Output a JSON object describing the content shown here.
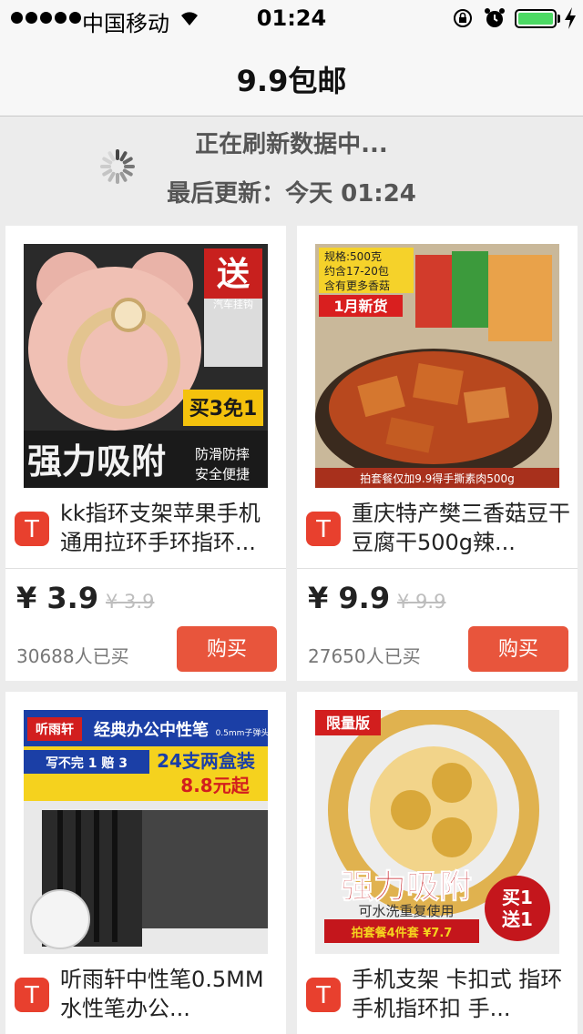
{
  "status_bar": {
    "carrier": "中国移动",
    "time": "01:24",
    "battery_level": 1.0,
    "icons": [
      "signal-dots",
      "wifi-icon",
      "orientation-lock-icon",
      "alarm-icon",
      "battery-icon",
      "charging-icon"
    ]
  },
  "nav": {
    "title": "9.9包邮"
  },
  "refresh": {
    "status": "正在刷新数据中...",
    "last_updated": "最后更新：今天 01:24"
  },
  "products": [
    {
      "title": "kk指环支架苹果手机通用拉环手环指环...",
      "price": "¥ 3.9",
      "original_price": "¥ 3.9",
      "sold": "30688人已买",
      "buy_label": "购买",
      "image_text": {
        "gift": "送",
        "gift_sub": "汽车挂钩",
        "promo": "买3免1",
        "headline": "强力吸附",
        "tag1": "防滑防摔",
        "tag2": "安全便捷"
      }
    },
    {
      "title": "重庆特产樊三香菇豆干豆腐干500g辣...",
      "price": "¥ 9.9",
      "original_price": "¥ 9.9",
      "sold": "27650人已买",
      "buy_label": "购买",
      "image_text": {
        "spec1": "规格:500克",
        "spec2": "约含17-20包",
        "spec3": "含有更多香菇",
        "badge": "1月新货",
        "footer": "拍套餐仅加9.9得手撕素肉500g"
      }
    },
    {
      "title": "听雨轩中性笔0.5MM水性笔办公...",
      "image_text": {
        "brand": "听雨轩",
        "headline": "经典办公中性笔",
        "sub": "0.5mm子弹头",
        "promo1": "写不完 1 赔 3",
        "promo2": "24支两盒装",
        "promo3": "8.8元起"
      }
    },
    {
      "title": "手机支架 卡扣式 指环 手机指环扣 手...",
      "image_text": {
        "badge": "限量版",
        "headline": "强力吸附",
        "sub": "可水洗重复使用",
        "promo": "拍套餐4件套 ¥7.7",
        "gift1": "买1",
        "gift2": "送1"
      }
    }
  ],
  "colors": {
    "accent": "#e8553c",
    "tmall": "#e8402e",
    "background": "#ececec"
  }
}
